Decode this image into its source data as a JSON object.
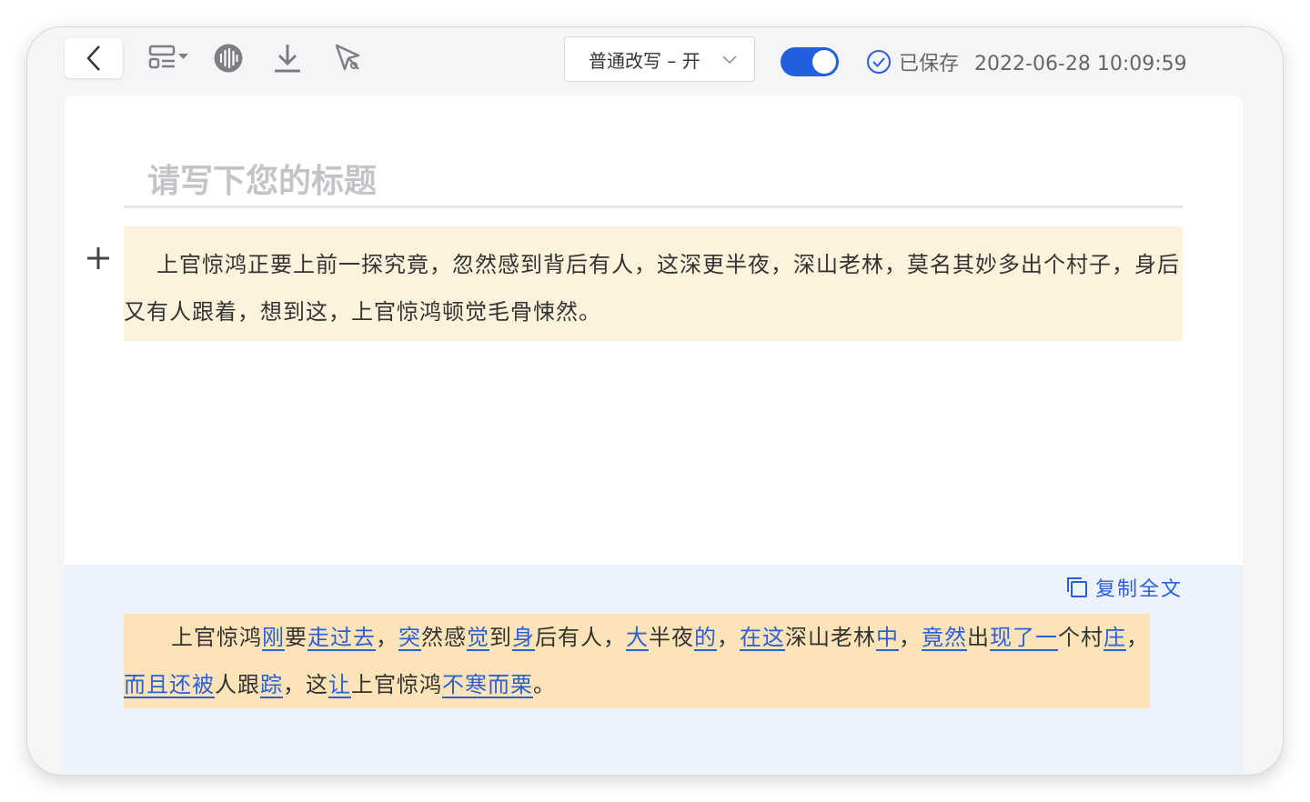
{
  "toolbar": {
    "mode_label": "普通改写 – 开",
    "toggle_on": true,
    "saved_label": "已保存",
    "saved_time": "2022-06-28 10:09:59",
    "icons": [
      "back-icon",
      "layout-menu-icon",
      "audio-wave-icon",
      "download-icon",
      "magic-wand-icon"
    ]
  },
  "editor": {
    "title_placeholder": "请写下您的标题",
    "paragraph": "上官惊鸿正要上前一探究竟，忽然感到背后有人，这深更半夜，深山老林，莫名其妙多出个村子，身后又有人跟着，想到这，上官惊鸿顿觉毛骨悚然。"
  },
  "result": {
    "copy_label": "复制全文",
    "segments": [
      {
        "t": "上官惊鸿",
        "h": false
      },
      {
        "t": "刚",
        "h": true
      },
      {
        "t": "要",
        "h": false
      },
      {
        "t": "走过去",
        "h": true
      },
      {
        "t": "，",
        "h": false
      },
      {
        "t": "突",
        "h": true
      },
      {
        "t": "然感",
        "h": false
      },
      {
        "t": "觉",
        "h": true
      },
      {
        "t": "到",
        "h": false
      },
      {
        "t": "身",
        "h": true
      },
      {
        "t": "后有人，",
        "h": false
      },
      {
        "t": "大",
        "h": true
      },
      {
        "t": "半夜",
        "h": false
      },
      {
        "t": "的",
        "h": true
      },
      {
        "t": "，",
        "h": false
      },
      {
        "t": "在这",
        "h": true
      },
      {
        "t": "深山老林",
        "h": false
      },
      {
        "t": "中",
        "h": true
      },
      {
        "t": "，",
        "h": false
      },
      {
        "t": "竟然",
        "h": true
      },
      {
        "t": "出",
        "h": false
      },
      {
        "t": "现了一",
        "h": true
      },
      {
        "t": "个村",
        "h": false
      },
      {
        "t": "庄",
        "h": true
      },
      {
        "t": "，",
        "h": false
      },
      {
        "t": "而且还被",
        "h": true
      },
      {
        "t": "人跟",
        "h": false
      },
      {
        "t": "踪",
        "h": true
      },
      {
        "t": "，这",
        "h": false
      },
      {
        "t": "让",
        "h": true
      },
      {
        "t": "上官惊鸿",
        "h": false
      },
      {
        "t": "不寒而栗",
        "h": true
      },
      {
        "t": "。",
        "h": false
      }
    ]
  }
}
